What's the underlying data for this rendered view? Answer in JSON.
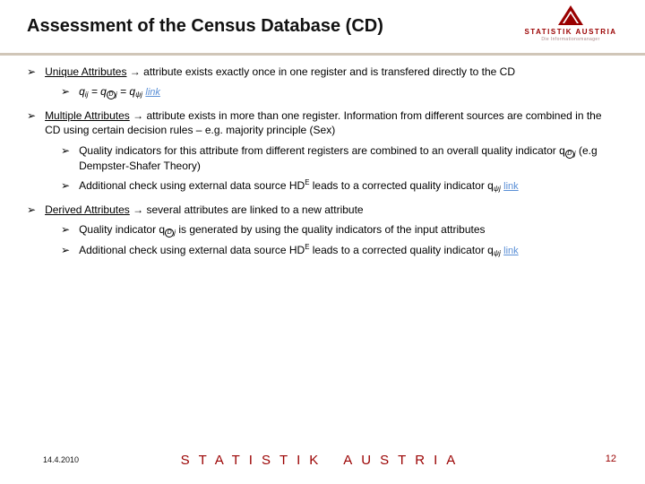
{
  "header": {
    "title": "Assessment of the Census Database (CD)",
    "logo_label": "STATISTIK AUSTRIA",
    "logo_sub": "Die Informationsmanager"
  },
  "bullets": {
    "unique": {
      "label": "Unique Attributes",
      "arrow": "→",
      "text": "attribute exists exactly once in one register and is transfered directly to the CD",
      "sub1_prefix": "q",
      "sub1_ij": "ij",
      "sub1_eq": " = q",
      "sub1_d": "D",
      "sub1_j1": "j",
      "sub1_eq2": " = q",
      "sub1_psi": "ψj",
      "sub1_link": "link"
    },
    "multiple": {
      "label": "Multiple Attributes",
      "arrow": "→",
      "text": "attribute exists in more than one register. Information from different sources are combined in the CD using certain decision rules – e.g. majority principle (Sex)",
      "sub1": "Quality indicators for this attribute from different registers are combined to an overall quality indicator q",
      "sub1_d": "D",
      "sub1_j": "j",
      "sub1_tail": " (e.g Dempster-Shafer Theory)",
      "sub2a": "Additional check using external data source HD",
      "sub2e": "E",
      "sub2b": " leads to a corrected quality indicator q",
      "sub2_psi": "ψj",
      "sub2_link": "link"
    },
    "derived": {
      "label": "Derived Attributes",
      "arrow": "→",
      "text": "several attributes are linked to a new attribute",
      "sub1a": "Quality indicator q",
      "sub1_d": "D",
      "sub1_j": "j",
      "sub1b": " is generated by using the quality indicators of the input attributes",
      "sub2a": "Additional check using external data source HD",
      "sub2e": "E",
      "sub2b": " leads to a corrected quality indicator q",
      "sub2_psi": "ψj",
      "sub2_link": "link"
    }
  },
  "footer": {
    "date": "14.4.2010",
    "brand1": "STATISTIK",
    "brand2": "AUSTRIA",
    "page": "12"
  }
}
